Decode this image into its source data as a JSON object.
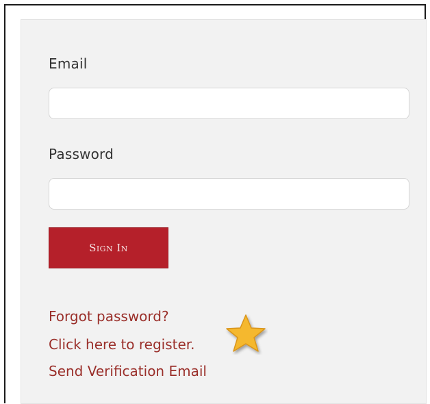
{
  "form": {
    "email_label": "Email",
    "email_value": "",
    "password_label": "Password",
    "password_value": "",
    "signin_label": "Sign In"
  },
  "links": {
    "forgot_password": "Forgot password?",
    "register": "Click here to register.",
    "send_verification": "Send Verification Email"
  },
  "annotation": {
    "icon": "star-icon",
    "color": "#f5b82e"
  },
  "colors": {
    "button": "#b5202a",
    "link": "#9a2f2a",
    "panel": "#f2f2f2"
  }
}
